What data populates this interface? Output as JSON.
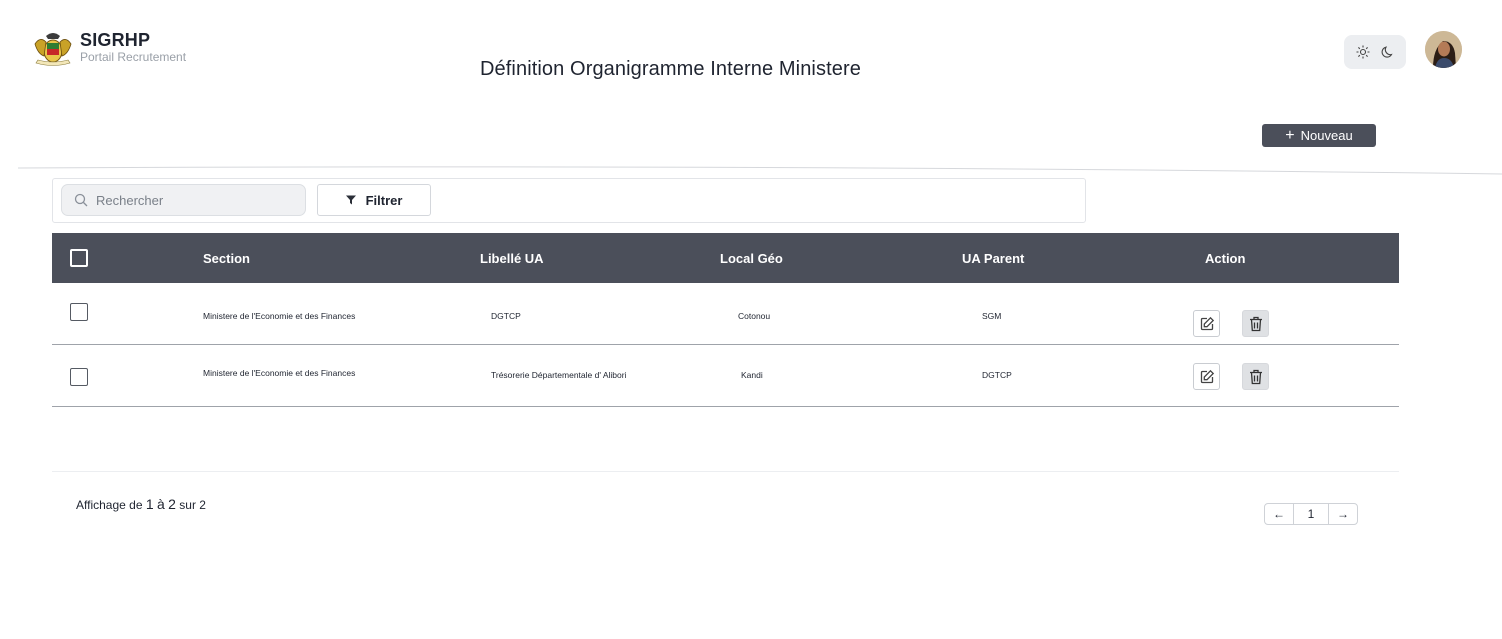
{
  "brand": {
    "title": "SIGRHP",
    "subtitle": "Portail Recrutement"
  },
  "page": {
    "title": "Définition Organigramme Interne Ministere"
  },
  "toolbar": {
    "new_label": "Nouveau",
    "search_placeholder": "Rechercher",
    "filter_label": "Filtrer"
  },
  "table": {
    "headers": {
      "section": "Section",
      "libelle": "Libellé UA",
      "local": "Local Géo",
      "parent": "UA Parent",
      "action": "Action"
    },
    "rows": [
      {
        "section": "Ministere de l'Economie et des Finances",
        "libelle": "DGTCP",
        "local": "Cotonou",
        "parent": "SGM"
      },
      {
        "section": "Ministere de l'Economie et des Finances",
        "libelle": "Trésorerie Départementale d' Alibori",
        "local": "Kandi",
        "parent": "DGTCP"
      }
    ]
  },
  "pagination": {
    "summary_prefix": "Affichage de",
    "from": "1",
    "between": "à",
    "to": "2",
    "summary_suffix": "sur 2",
    "current_page": "1",
    "prev_icon": "←",
    "next_icon": "→"
  },
  "icons": {
    "theme_light": "sun-icon",
    "theme_dark": "moon-icon",
    "search": "search-icon",
    "filter": "filter-icon",
    "edit": "edit-icon",
    "delete": "trash-icon"
  },
  "colors": {
    "header_bg": "#4b4f5a",
    "accent": "#4b4f5a"
  }
}
